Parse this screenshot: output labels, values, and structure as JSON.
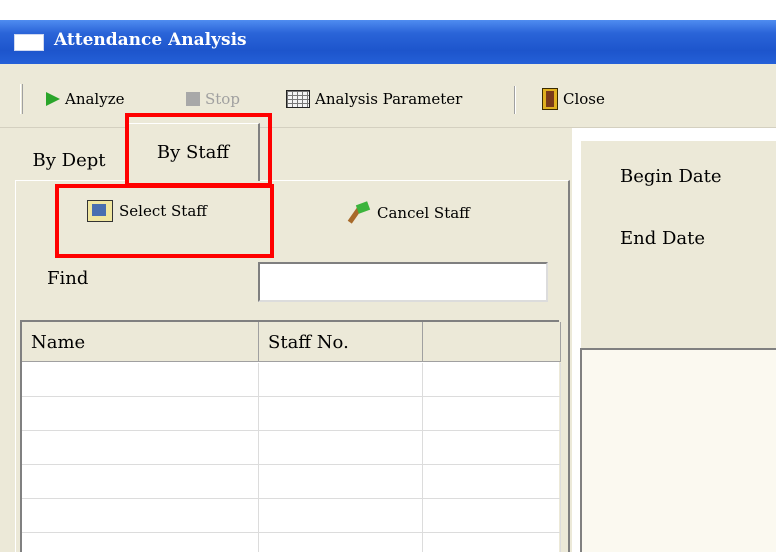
{
  "window": {
    "title": "Attendance Analysis"
  },
  "toolbar": {
    "analyze": "Analyze",
    "stop": "Stop",
    "analysis_parameter": "Analysis Parameter",
    "close": "Close"
  },
  "tabs": {
    "by_dept": "By Dept",
    "by_staff": "By Staff",
    "active": "By Staff"
  },
  "staff_panel": {
    "select_staff": "Select Staff",
    "cancel_staff": "Cancel Staff",
    "find_label": "Find",
    "find_value": ""
  },
  "grid": {
    "columns": [
      "Name",
      "Staff No.",
      ""
    ],
    "rows": [
      [
        "",
        "",
        ""
      ],
      [
        "",
        "",
        ""
      ],
      [
        "",
        "",
        ""
      ],
      [
        "",
        "",
        ""
      ],
      [
        "",
        "",
        ""
      ],
      [
        "",
        "",
        ""
      ]
    ]
  },
  "right_panel": {
    "begin_date_label": "Begin Date",
    "end_date_label": "End Date"
  },
  "colors": {
    "titlebar": "#1d55cc",
    "highlight": "#ff0000",
    "panel": "#ece9d8"
  }
}
